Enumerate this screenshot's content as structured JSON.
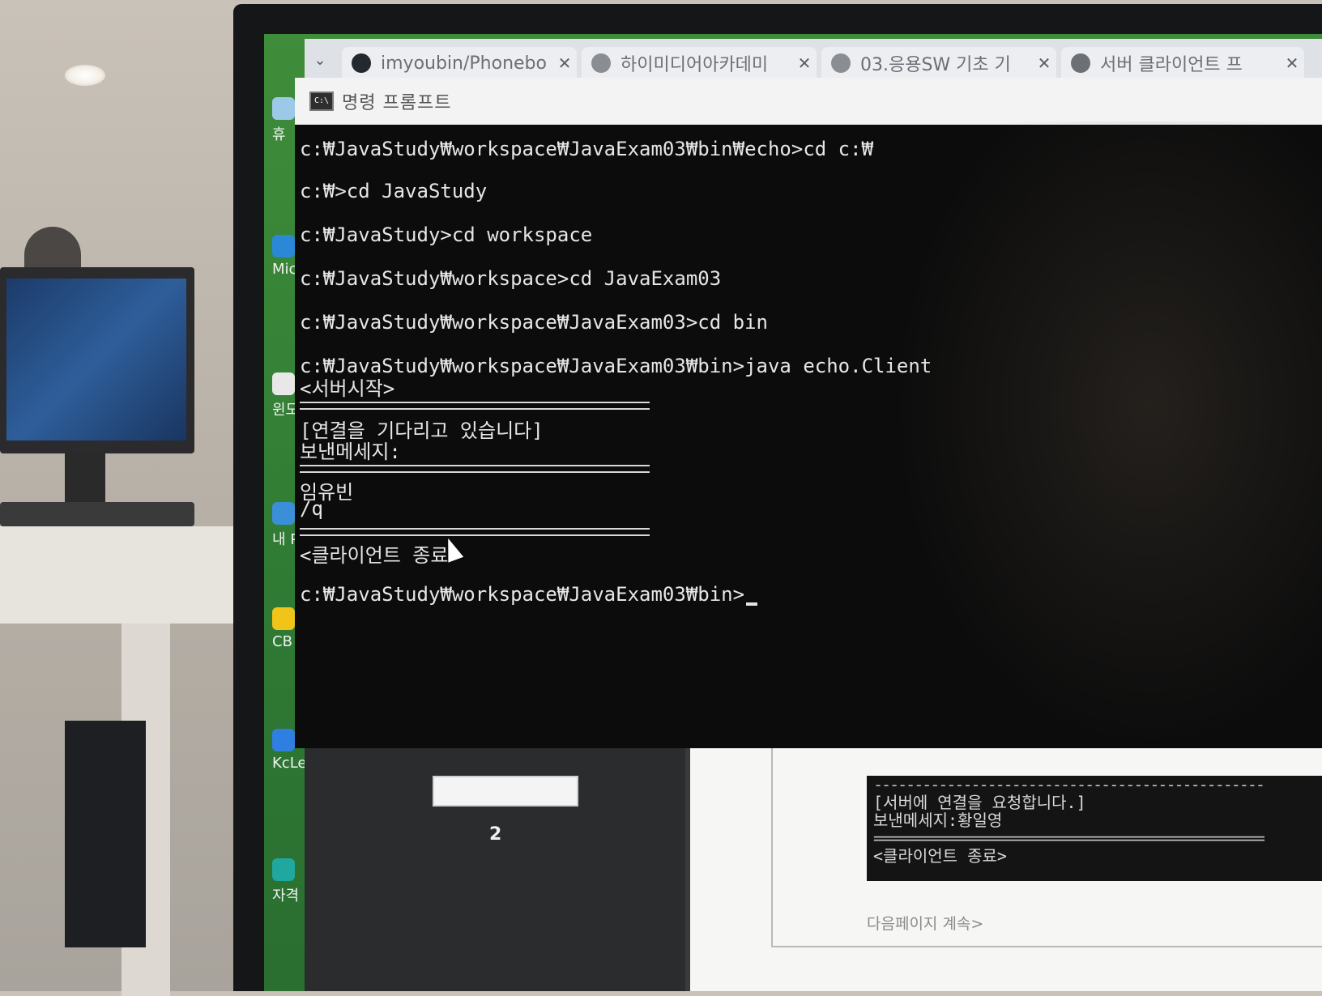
{
  "browser": {
    "tabs": [
      {
        "title": "imyoubin/Phonebo",
        "icon": "github-icon"
      },
      {
        "title": "하이미디어아카데미",
        "icon": "globe-icon"
      },
      {
        "title": "03.응용SW 기초 기",
        "icon": "globe-icon"
      },
      {
        "title": "서버 클라이언트 프",
        "icon": "chatgpt-icon"
      }
    ],
    "close_glyph": "✕",
    "menu_glyph": "⌄"
  },
  "desktop_icons": [
    {
      "label": "휴"
    },
    {
      "label": "Mic"
    },
    {
      "label": "윈도"
    },
    {
      "label": "내 P"
    },
    {
      "label": "CB"
    },
    {
      "label": "KcLe"
    },
    {
      "label": "자격"
    }
  ],
  "cmd": {
    "window_title": "명령 프롬프트",
    "icon_text": "C:\\",
    "lines": [
      "c:₩JavaStudy₩workspace₩JavaExam03₩bin₩echo>cd c:₩",
      "c:₩>cd JavaStudy",
      "c:₩JavaStudy>cd workspace",
      "c:₩JavaStudy₩workspace>cd JavaExam03",
      "c:₩JavaStudy₩workspace₩JavaExam03>cd bin",
      "c:₩JavaStudy₩workspace₩JavaExam03₩bin>java echo.Client",
      "<서버시작>",
      "[연결을 기다리고 있습니다]",
      "보낸메세지:",
      "임유빈",
      "/q",
      "<클라이언트 종료>",
      "c:₩JavaStudy₩workspace₩JavaExam03₩bin>"
    ]
  },
  "document": {
    "page_number": "2",
    "console_lines": [
      "[서버에 연결을 요청합니다.]",
      "보낸메세지:황일영",
      "<클라이언트 종료>"
    ],
    "footer": "다음페이지 계속>"
  }
}
